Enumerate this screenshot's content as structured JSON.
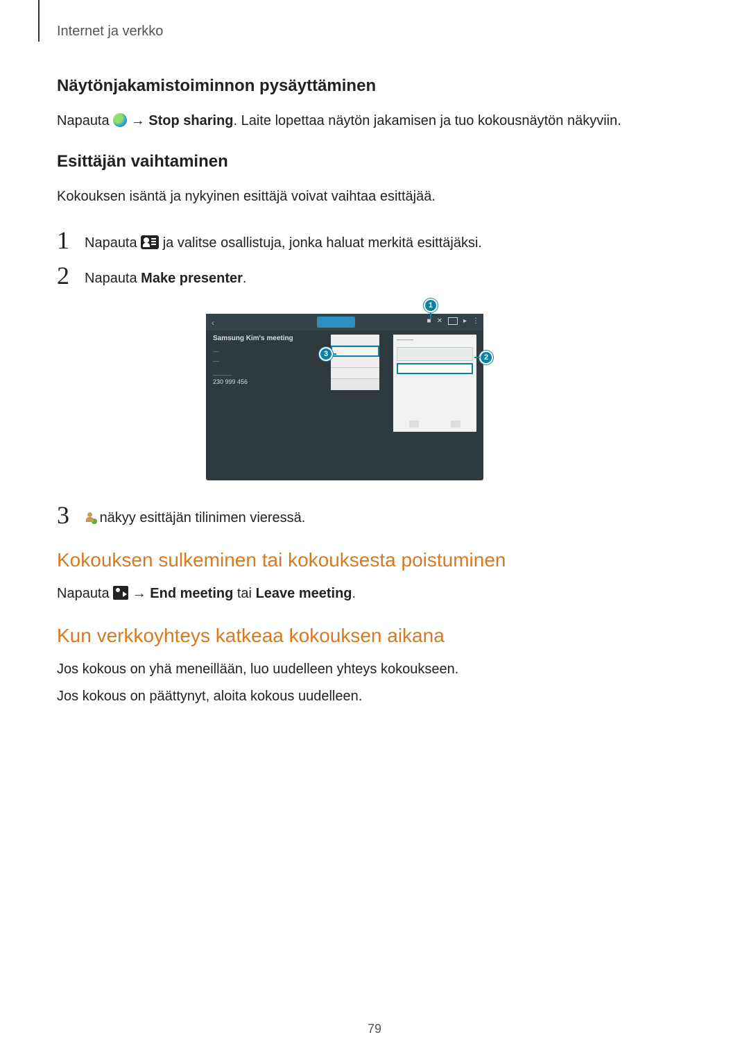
{
  "header": {
    "chapter": "Internet ja verkko"
  },
  "section1": {
    "heading": "Näytönjakamistoiminnon pysäyttäminen",
    "p_before": "Napauta ",
    "arrow": " → ",
    "bold1": "Stop sharing",
    "p_after": ". Laite lopettaa näytön jakamisen ja tuo kokousnäytön näkyviin."
  },
  "section2": {
    "heading": "Esittäjän vaihtaminen",
    "intro": "Kokouksen isäntä ja nykyinen esittäjä voivat vaihtaa esittäjää.",
    "steps": [
      {
        "n": "1",
        "before": "Napauta ",
        "after": " ja valitse osallistuja, jonka haluat merkitä esittäjäksi."
      },
      {
        "n": "2",
        "before": "Napauta ",
        "bold": "Make presenter",
        "after": "."
      },
      {
        "n": "3",
        "after": " näkyy esittäjän tilinimen vieressä."
      }
    ]
  },
  "callouts": {
    "c1": "1",
    "c2": "2",
    "c3": "3"
  },
  "screenshot": {
    "title": "Samsung Kim's meeting",
    "id_line": "230 999 456"
  },
  "section3": {
    "heading": "Kokouksen sulkeminen tai kokouksesta poistuminen",
    "p_before": "Napauta ",
    "arrow": " → ",
    "bold1": "End meeting",
    "mid": " tai ",
    "bold2": "Leave meeting",
    "after": "."
  },
  "section4": {
    "heading": "Kun verkkoyhteys katkeaa kokouksen aikana",
    "p1": "Jos kokous on yhä meneillään, luo uudelleen yhteys kokoukseen.",
    "p2": "Jos kokous on päättynyt, aloita kokous uudelleen."
  },
  "page": "79"
}
